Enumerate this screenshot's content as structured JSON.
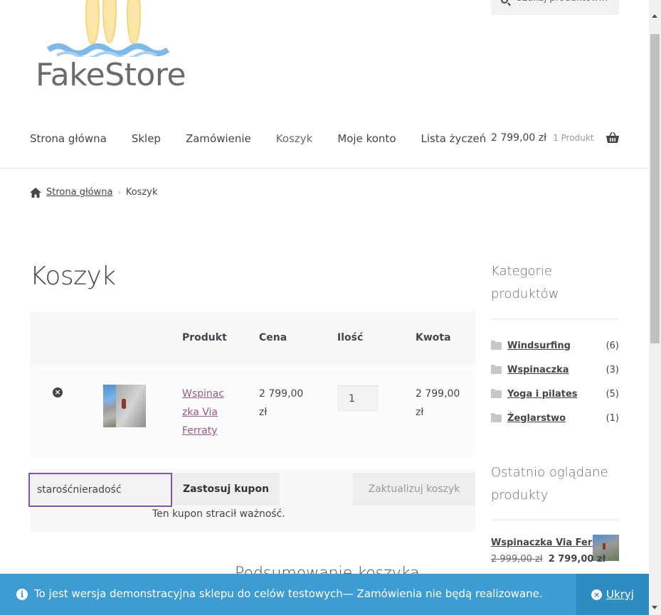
{
  "logo": {
    "text": "FakeStore"
  },
  "search": {
    "placeholder": "Szukaj produktów…"
  },
  "nav": {
    "items": [
      {
        "label": "Strona główna"
      },
      {
        "label": "Sklep"
      },
      {
        "label": "Zamówienie"
      },
      {
        "label": "Koszyk"
      },
      {
        "label": "Moje konto"
      },
      {
        "label": "Lista życzeń"
      }
    ]
  },
  "header_cart": {
    "amount": "2 799,00 zł",
    "count": "1 Produkt"
  },
  "breadcrumb": {
    "home": "Strona główna",
    "current": "Koszyk"
  },
  "page": {
    "title": "Koszyk"
  },
  "cart": {
    "columns": [
      "Produkt",
      "Cena",
      "Ilość",
      "Kwota"
    ],
    "items": [
      {
        "name": "Wspinaczka Via Ferraty",
        "price": "2 799,00 zł",
        "quantity": "1",
        "subtotal": "2 799,00 zł"
      }
    ],
    "coupon_value": "starośćnieradość",
    "apply_label": "Zastosuj kupon",
    "update_label": "Zaktualizuj koszyk",
    "coupon_message": "Ten kupon stracił ważność.",
    "totals_title": "Podsumowanie koszyka"
  },
  "sidebar": {
    "categories_title": "Kategorie produktów",
    "categories": [
      {
        "name": "Windsurfing",
        "count": "(6)"
      },
      {
        "name": "Wspinaczka",
        "count": "(3)"
      },
      {
        "name": "Yoga i pilates",
        "count": "(5)"
      },
      {
        "name": "Żeglarstwo",
        "count": "(1)"
      }
    ],
    "recent_title": "Ostatnio oglądane produkty",
    "recent": [
      {
        "name": "Wspinaczka Via Ferraty",
        "old_price": "2 999,00 zł",
        "new_price": "2 799,00 zł"
      }
    ]
  },
  "notice": {
    "text": "To jest wersja demonstracyjna sklepu do celów testowych— Zamówienia nie będą realizowane.",
    "dismiss_label": "Ukryj"
  },
  "colors": {
    "accent": "#96588a",
    "notice_bg": "#3d9cd2",
    "focus": "#7f54b3"
  }
}
